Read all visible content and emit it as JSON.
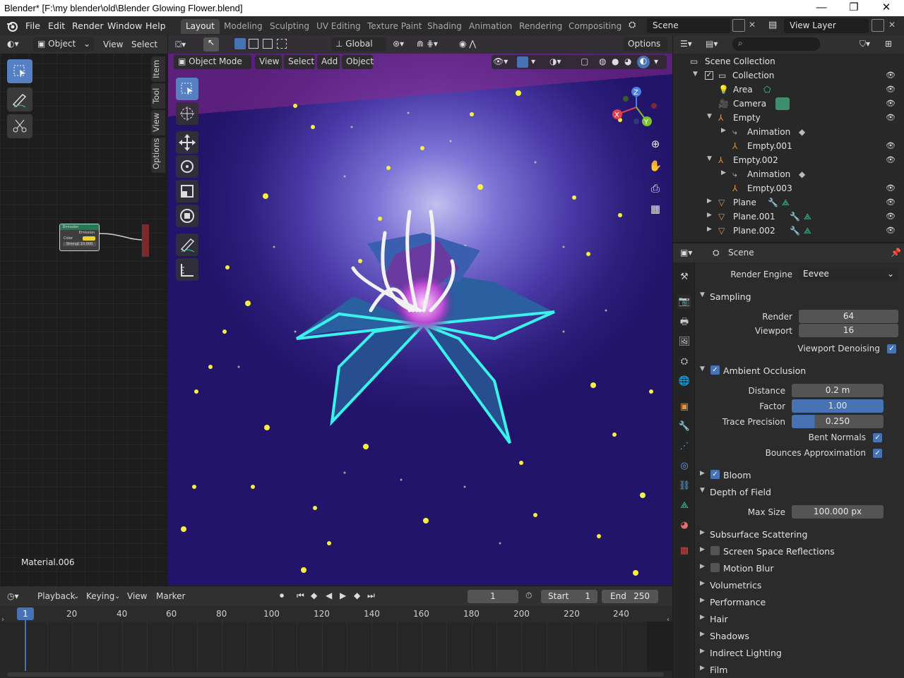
{
  "window": {
    "title": "Blender* [F:\\my blender\\old\\Blender Glowing Flower.blend]",
    "minimize": "—",
    "maximize": "❐",
    "close": "✕"
  },
  "menu": {
    "items": [
      "File",
      "Edit",
      "Render",
      "Window",
      "Help"
    ]
  },
  "workspaces": [
    "Layout",
    "Modeling",
    "Sculpting",
    "UV Editing",
    "Texture Paint",
    "Shading",
    "Animation",
    "Rendering",
    "Compositing"
  ],
  "active_workspace": "Layout",
  "scene_field": "Scene",
  "view_layer_field": "View Layer",
  "node_editor": {
    "object_dropdown": "Object",
    "menus": [
      "View",
      "Select"
    ],
    "tabs": [
      "Item",
      "Tool",
      "View",
      "Options"
    ],
    "node_title": "Emission",
    "node_output": "Emission",
    "node_color_label": "Color",
    "node_strength": "Strengt 10.000",
    "material_label": "Material.006"
  },
  "viewport": {
    "orientation": "Global",
    "options_label": "Options",
    "mode_dropdown": "Object Mode",
    "menus": [
      "View",
      "Select",
      "Add",
      "Object"
    ],
    "gizmo": {
      "x": "X",
      "y": "Y",
      "z": "Z"
    }
  },
  "outliner": {
    "search_placeholder": "",
    "rows": [
      {
        "label": "Scene Collection",
        "icon": "collection-icon"
      },
      {
        "label": "Collection",
        "icon": "collection-icon"
      },
      {
        "label": "Area",
        "icon": "light-icon"
      },
      {
        "label": "Camera",
        "icon": "camera-icon"
      },
      {
        "label": "Empty",
        "icon": "empty-icon"
      },
      {
        "label": "Animation",
        "icon": "action-icon"
      },
      {
        "label": "Empty.001",
        "icon": "empty-icon"
      },
      {
        "label": "Empty.002",
        "icon": "empty-icon"
      },
      {
        "label": "Animation",
        "icon": "action-icon"
      },
      {
        "label": "Empty.003",
        "icon": "empty-icon"
      },
      {
        "label": "Plane",
        "icon": "mesh-icon"
      },
      {
        "label": "Plane.001",
        "icon": "mesh-icon"
      },
      {
        "label": "Plane.002",
        "icon": "mesh-icon"
      }
    ]
  },
  "properties": {
    "context": "Scene",
    "render_engine_label": "Render Engine",
    "render_engine": "Eevee",
    "sampling": {
      "title": "Sampling",
      "render_label": "Render",
      "render_value": "64",
      "viewport_label": "Viewport",
      "viewport_value": "16",
      "denoise_label": "Viewport Denoising"
    },
    "ao": {
      "title": "Ambient Occlusion",
      "distance_label": "Distance",
      "distance_value": "0.2 m",
      "factor_label": "Factor",
      "factor_value": "1.00",
      "trace_label": "Trace Precision",
      "trace_value": "0.250",
      "bent_label": "Bent Normals",
      "bounces_label": "Bounces Approximation"
    },
    "bloom": "Bloom",
    "dof": {
      "title": "Depth of Field",
      "max_size_label": "Max Size",
      "max_size_value": "100.000 px"
    },
    "panels": [
      "Subsurface Scattering",
      "Screen Space Reflections",
      "Motion Blur",
      "Volumetrics",
      "Performance",
      "Hair",
      "Shadows",
      "Indirect Lighting",
      "Film"
    ]
  },
  "timeline": {
    "menus": [
      "Playback",
      "Keying",
      "View",
      "Marker"
    ],
    "current_frame": "1",
    "start_label": "Start",
    "start_value": "1",
    "end_label": "End",
    "end_value": "250",
    "ruler": [
      "1",
      "20",
      "40",
      "60",
      "80",
      "100",
      "120",
      "140",
      "160",
      "180",
      "200",
      "220",
      "240"
    ]
  },
  "colors": {
    "accent": "#4772b3",
    "viewport_bg": "#2c1e7a",
    "glow": "#38e8e0"
  }
}
